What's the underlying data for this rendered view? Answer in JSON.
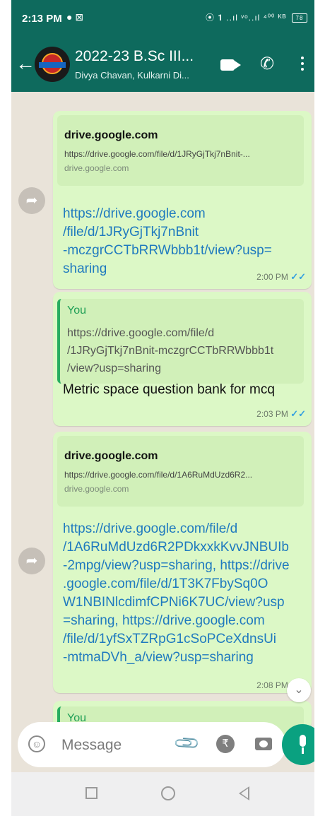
{
  "status_bar": {
    "time": "2:13 PM",
    "left_icons": "● ⊠",
    "right_icons": "⦿ 𝟏 ..ıl ᵛᵒ..ıl ⁴⁰⁰ ᴷᴮ",
    "battery": "78"
  },
  "header": {
    "title": "2022-23 B.Sc III...",
    "subtitle": "Divya Chavan, Kulkarni Di..."
  },
  "messages": [
    {
      "preview_host": "drive.google.com",
      "preview_url": "https://drive.google.com/file/d/1JRyGjTkj7nBnit-...",
      "preview_domain": "drive.google.com",
      "link_lines": [
        "https://drive.google.com",
        "/file/d/1JRyGjTkj7nBnit",
        "-mczgrCCTbRRWbbb1t/view?usp=",
        "sharing"
      ],
      "time": "2:00 PM",
      "ticks": "✓✓"
    },
    {
      "quote_sender": "You",
      "quote_lines": [
        "https://drive.google.com/file/d",
        "/1JRyGjTkj7nBnit-mczgrCCTbRRWbbb1t",
        "/view?usp=sharing"
      ],
      "text": "Metric space question bank for mcq",
      "time": "2:03 PM",
      "ticks": "✓✓"
    },
    {
      "preview_host": "drive.google.com",
      "preview_url": "https://drive.google.com/file/d/1A6RuMdUzd6R2...",
      "preview_domain": "drive.google.com",
      "link_lines": [
        "https://drive.google.com/file/d",
        "/1A6RuMdUzd6R2PDkxxkKvvJNBUIb",
        "-2mpg/view?usp=sharing, https://drive",
        ".google.com/file/d/1T3K7FbySq0O",
        "W1NBINlcdimfCPNi6K7UC/view?usp",
        "=sharing, https://drive.google.com",
        "/file/d/1yfSxTZRpG1cSoPCeXdnsUi",
        "-mtmaDVh_a/view?usp=sharing"
      ],
      "time": "2:08 PM",
      "ticks": "✓✓"
    },
    {
      "quote_sender": "You"
    }
  ],
  "composer": {
    "placeholder": "Message"
  }
}
